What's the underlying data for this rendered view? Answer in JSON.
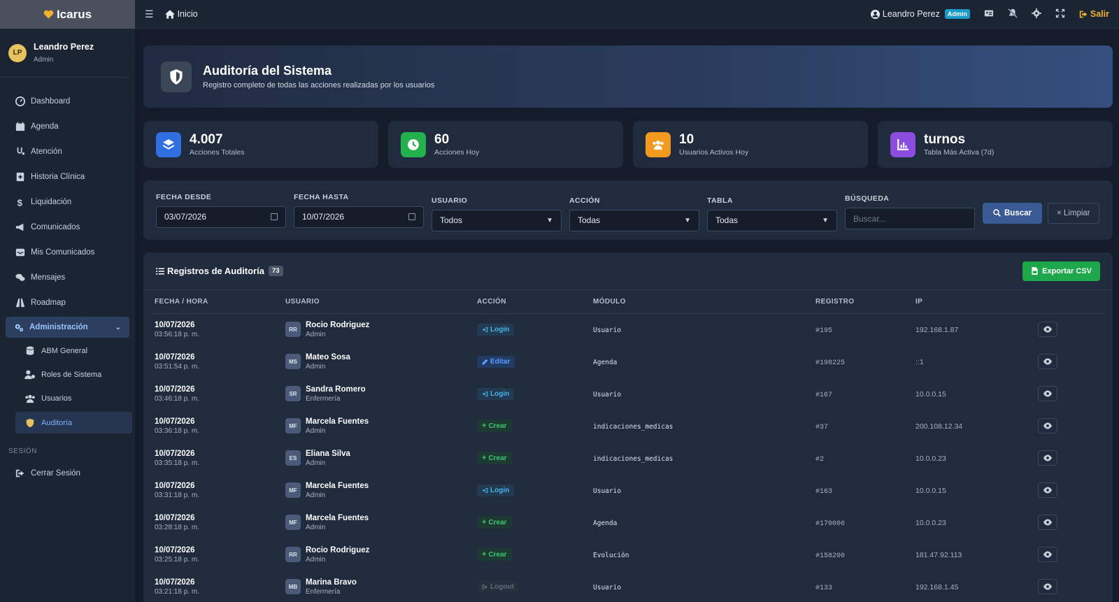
{
  "brand": {
    "name": "Icarus"
  },
  "user": {
    "initials": "LP",
    "name": "Leandro Perez",
    "role": "Admin"
  },
  "nav": {
    "items": [
      {
        "label": "Dashboard",
        "icon": "dashboard-icon"
      },
      {
        "label": "Agenda",
        "icon": "calendar-icon"
      },
      {
        "label": "Atención",
        "icon": "stethoscope-icon"
      },
      {
        "label": "Historia Clínica",
        "icon": "medical-record-icon"
      },
      {
        "label": "Liquidación",
        "icon": "dollar-icon"
      },
      {
        "label": "Comunicados",
        "icon": "megaphone-icon"
      },
      {
        "label": "Mis Comunicados",
        "icon": "inbox-icon"
      },
      {
        "label": "Mensajes",
        "icon": "chat-icon"
      },
      {
        "label": "Roadmap",
        "icon": "road-icon"
      }
    ],
    "admin": {
      "label": "Administración",
      "icon": "gears-icon"
    },
    "sub": [
      {
        "label": "ABM General",
        "icon": "database-icon"
      },
      {
        "label": "Roles de Sistema",
        "icon": "user-cog-icon"
      },
      {
        "label": "Usuarios",
        "icon": "users-icon"
      },
      {
        "label": "Auditoría",
        "icon": "shield-icon"
      }
    ],
    "session_header": "SESIÓN",
    "logout": {
      "label": "Cerrar Sesión",
      "icon": "sign-out-icon"
    }
  },
  "topbar": {
    "home": "Inicio",
    "user_name": "Leandro Perez",
    "user_badge": "Admin",
    "exit": "Salir"
  },
  "hero": {
    "title": "Auditoría del Sistema",
    "subtitle": "Registro completo de todas las acciones realizadas por los usuarios"
  },
  "stats": [
    {
      "value": "4.007",
      "label": "Acciones Totales",
      "color": "#2f6fe0"
    },
    {
      "value": "60",
      "label": "Acciones Hoy",
      "color": "#22b14c"
    },
    {
      "value": "10",
      "label": "Usuarios Activos Hoy",
      "color": "#f29a1f"
    },
    {
      "value": "turnos",
      "label": "Tabla Más Activa (7d)",
      "color": "#8a4de0"
    }
  ],
  "filters": {
    "fecha_desde": {
      "label": "FECHA DESDE",
      "value": "03/07/2026"
    },
    "fecha_hasta": {
      "label": "FECHA HASTA",
      "value": "10/07/2026"
    },
    "usuario": {
      "label": "USUARIO",
      "value": "Todos"
    },
    "accion": {
      "label": "ACCIÓN",
      "value": "Todas"
    },
    "tabla": {
      "label": "TABLA",
      "value": "Todas"
    },
    "busqueda": {
      "label": "BÚSQUEDA",
      "placeholder": "Buscar..."
    },
    "buscar": "Buscar",
    "limpiar": "× Limpiar"
  },
  "table": {
    "title": "Registros de Auditoría",
    "count": "73",
    "export": "Exportar CSV",
    "columns": [
      "FECHA / HORA",
      "USUARIO",
      "ACCIÓN",
      "MÓDULO",
      "REGISTRO",
      "IP",
      ""
    ],
    "rows": [
      {
        "date": "10/07/2026",
        "time": "03:56:18 p. m.",
        "initials": "RR",
        "user": "Rocio Rodriguez",
        "role": "Admin",
        "action": "Login",
        "type": "login",
        "module": "Usuario",
        "record": "#195",
        "ip": "192.168.1.87"
      },
      {
        "date": "10/07/2026",
        "time": "03:51:54 p. m.",
        "initials": "MS",
        "user": "Mateo Sosa",
        "role": "Admin",
        "action": "Editar",
        "type": "editar",
        "module": "Agenda",
        "record": "#198225",
        "ip": "::1"
      },
      {
        "date": "10/07/2026",
        "time": "03:46:18 p. m.",
        "initials": "SR",
        "user": "Sandra Romero",
        "role": "Enfermería",
        "action": "Login",
        "type": "login",
        "module": "Usuario",
        "record": "#167",
        "ip": "10.0.0.15"
      },
      {
        "date": "10/07/2026",
        "time": "03:36:18 p. m.",
        "initials": "MF",
        "user": "Marcela Fuentes",
        "role": "Admin",
        "action": "Crear",
        "type": "crear",
        "module": "indicaciones_medicas",
        "record": "#37",
        "ip": "200.108.12.34"
      },
      {
        "date": "10/07/2026",
        "time": "03:35:18 p. m.",
        "initials": "ES",
        "user": "Eliana Silva",
        "role": "Admin",
        "action": "Crear",
        "type": "crear",
        "module": "indicaciones_medicas",
        "record": "#2",
        "ip": "10.0.0.23"
      },
      {
        "date": "10/07/2026",
        "time": "03:31:18 p. m.",
        "initials": "MF",
        "user": "Marcela Fuentes",
        "role": "Admin",
        "action": "Login",
        "type": "login",
        "module": "Usuario",
        "record": "#163",
        "ip": "10.0.0.15"
      },
      {
        "date": "10/07/2026",
        "time": "03:28:18 p. m.",
        "initials": "MF",
        "user": "Marcela Fuentes",
        "role": "Admin",
        "action": "Crear",
        "type": "crear",
        "module": "Agenda",
        "record": "#170006",
        "ip": "10.0.0.23"
      },
      {
        "date": "10/07/2026",
        "time": "03:25:18 p. m.",
        "initials": "RR",
        "user": "Rocio Rodriguez",
        "role": "Admin",
        "action": "Crear",
        "type": "crear",
        "module": "Evolución",
        "record": "#158200",
        "ip": "181.47.92.113"
      },
      {
        "date": "10/07/2026",
        "time": "03:21:18 p. m.",
        "initials": "MB",
        "user": "Marina Bravo",
        "role": "Enfermería",
        "action": "Logout",
        "type": "logout",
        "module": "Usuario",
        "record": "#133",
        "ip": "192.168.1.45"
      }
    ]
  }
}
